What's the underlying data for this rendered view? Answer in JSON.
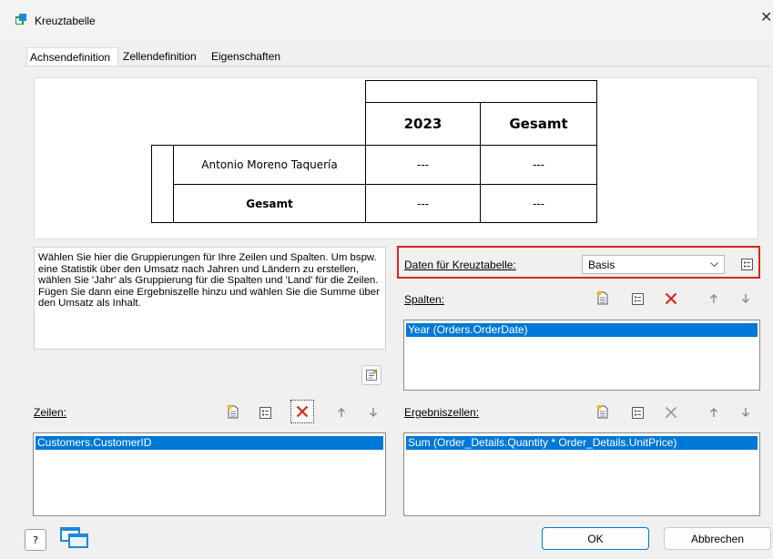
{
  "window": {
    "title": "Kreuztabelle",
    "close_glyph": "✕",
    "icon": "kreuztabelle-app-icon"
  },
  "tabs": [
    {
      "label": "Achsendefinition",
      "active": true
    },
    {
      "label": "Zellendefinition",
      "active": false
    },
    {
      "label": "Eigenschaften",
      "active": false
    }
  ],
  "preview": {
    "col_header": "2023",
    "col_total": "Gesamt",
    "row_label": "Antonio Moreno Taquería",
    "row_total": "Gesamt",
    "cell_value": "---"
  },
  "help_text": "Wählen Sie hier die Gruppierungen für Ihre Zeilen und Spalten. Um bspw. eine Statistik über den Umsatz nach Jahren und Ländern zu erstellen, wählen Sie 'Jahr' als Gruppierung für die Spalten und 'Land' für die Zeilen. Fügen Sie dann eine Ergebniszelle hinzu und wählen Sie die Summe über den Umsatz als Inhalt.",
  "datasource": {
    "label": "Daten für Kreuztabelle:",
    "value": "Basis"
  },
  "spalten": {
    "label": "Spalten:",
    "items": [
      "Year (Orders.OrderDate)"
    ]
  },
  "zeilen": {
    "label": "Zeilen:",
    "items": [
      "Customers.CustomerID"
    ]
  },
  "ergebnis": {
    "label": "Ergebniszellen:",
    "items": [
      "Sum (Order_Details.Quantity * Order_Details.UnitPrice)"
    ]
  },
  "buttons": {
    "ok": "OK",
    "cancel": "Abbrechen",
    "help_glyph": "?"
  },
  "colors": {
    "selection": "#0078d7",
    "delete_red": "#d9261c",
    "highlight_border": "#d9261c"
  }
}
